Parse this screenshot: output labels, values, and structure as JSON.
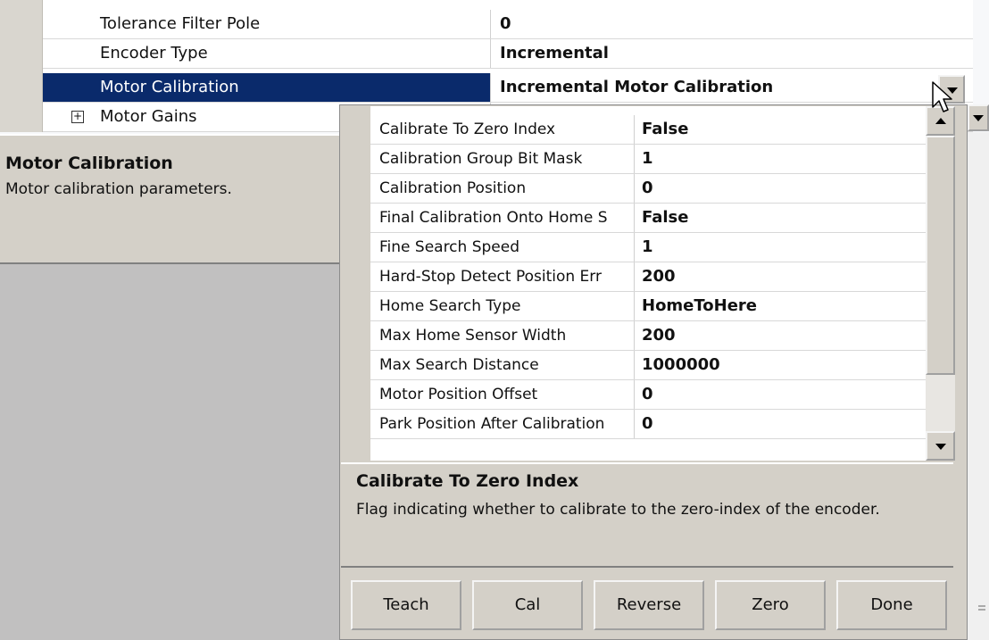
{
  "outer_grid": {
    "rows": [
      {
        "name": "Tolerance Filter Pole",
        "value": "0"
      },
      {
        "name": "Encoder Type",
        "value": "Incremental"
      },
      {
        "name": "Motor Calibration",
        "value": "Incremental Motor Calibration"
      },
      {
        "name": "Motor Gains",
        "value": ""
      }
    ],
    "expand_symbol": "+"
  },
  "outer_description": {
    "title": "Motor Calibration",
    "text": "Motor calibration parameters."
  },
  "popup": {
    "rows": [
      {
        "name": "Calibrate To Zero Index",
        "value": "False"
      },
      {
        "name": "Calibration Group Bit Mask",
        "value": "1"
      },
      {
        "name": "Calibration Position",
        "value": "0"
      },
      {
        "name": "Final Calibration Onto Home S",
        "value": "False"
      },
      {
        "name": "Fine Search Speed",
        "value": "1"
      },
      {
        "name": "Hard-Stop Detect Position Err",
        "value": "200"
      },
      {
        "name": "Home Search Type",
        "value": "HomeToHere"
      },
      {
        "name": "Max Home Sensor Width",
        "value": "200"
      },
      {
        "name": "Max Search Distance",
        "value": "1000000"
      },
      {
        "name": "Motor Position Offset",
        "value": "0"
      },
      {
        "name": "Park Position After Calibration",
        "value": "0"
      }
    ],
    "description": {
      "title": "Calibrate To Zero Index",
      "text": "Flag indicating whether to calibrate to the zero-index of the encoder."
    },
    "buttons": {
      "teach": "Teach",
      "cal": "Cal",
      "reverse": "Reverse",
      "zero": "Zero",
      "done": "Done"
    }
  },
  "colors": {
    "selected_row": "#0a2a6b",
    "panel": "#d4d0c8",
    "gray_area": "#c1c0c0"
  }
}
